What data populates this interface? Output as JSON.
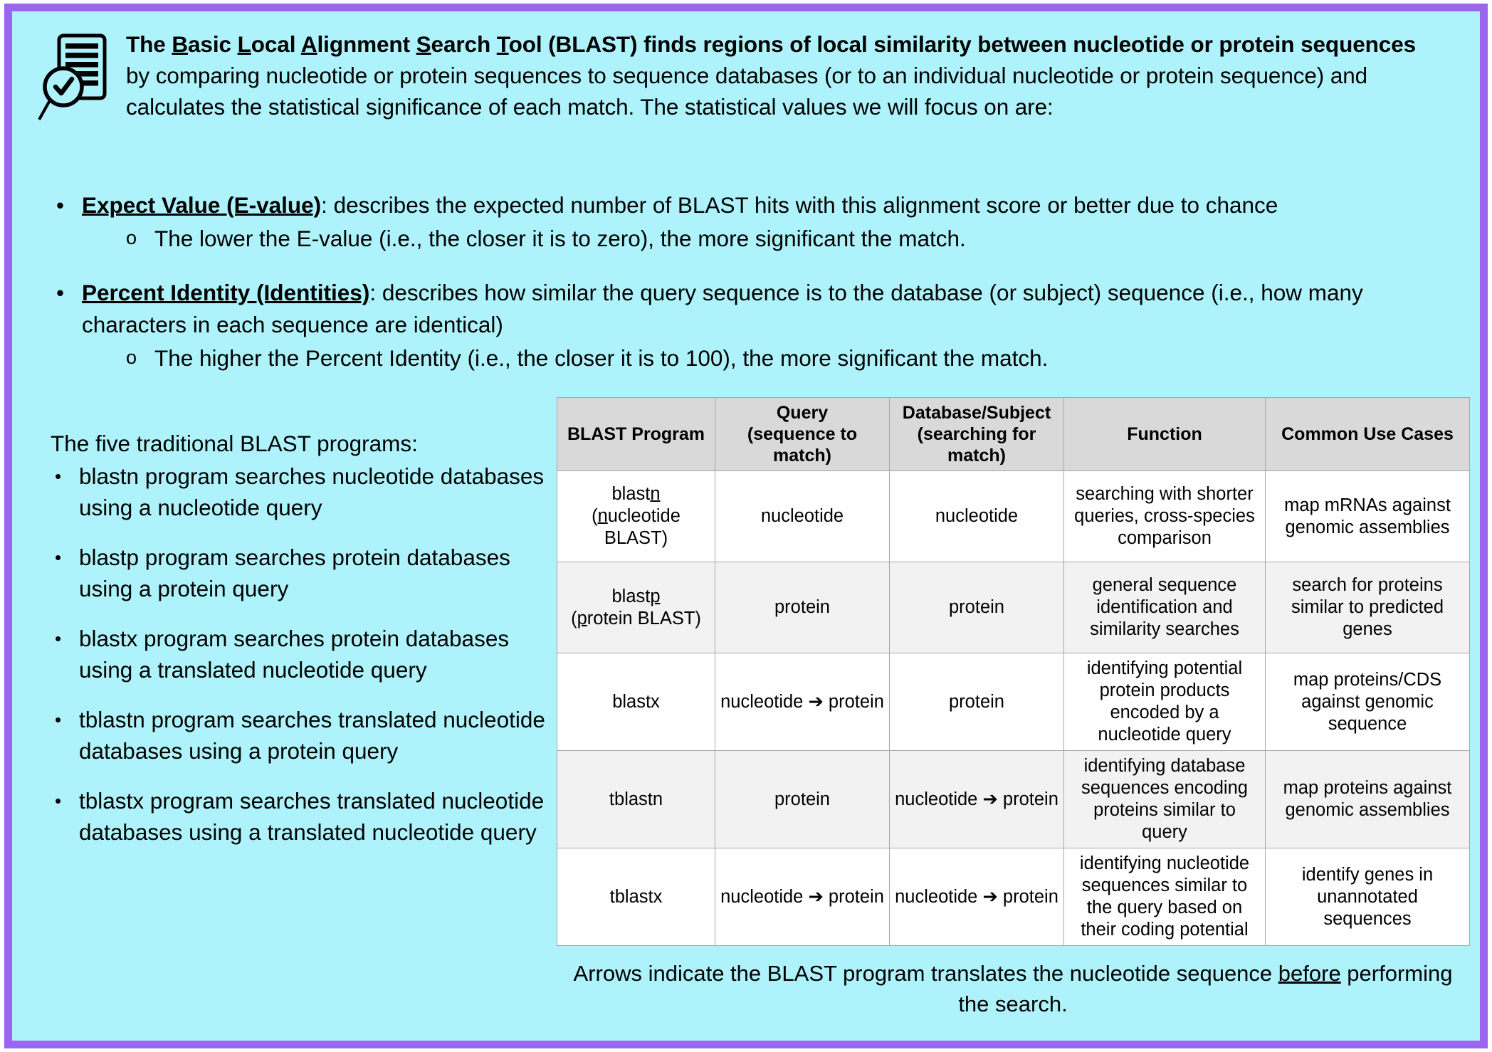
{
  "colors": {
    "frame_border": "#9a66f0",
    "background": "#aef3fb",
    "table_header_bg": "#d9d9d9",
    "table_row_shade": "#f2f2f2",
    "table_border": "#a6a6a6"
  },
  "header": {
    "icon": "document-magnifier-check-icon",
    "bold_lead": {
      "pre": "The ",
      "b1": "B",
      "w1": "asic ",
      "b2": "L",
      "w2": "ocal ",
      "b3": "A",
      "w3": "lignment ",
      "b4": "S",
      "w4": "earch ",
      "b5": "T",
      "w5": "ool (BLAST) finds regions of local similarity between nucleotide or protein sequences"
    },
    "rest": " by comparing nucleotide or protein sequences to sequence databases (or to an individual nucleotide or protein sequence) and calculates the statistical significance of each match. The statistical values we will focus on are:"
  },
  "stats": [
    {
      "bullet": "•",
      "term": "Expect Value (E-value)",
      "desc": ": describes the expected number of BLAST hits with this alignment score or better due to chance",
      "sub_marker": "o",
      "sub": "The lower the E-value (i.e., the closer it is to zero), the more significant the match."
    },
    {
      "bullet": "•",
      "term": "Percent Identity (Identities)",
      "desc": ": describes how similar the query sequence is to the database (or subject) sequence (i.e., how many characters in each sequence are identical)",
      "sub_marker": "o",
      "sub": "The higher the Percent Identity (i.e., the closer it is to 100), the more significant the match."
    }
  ],
  "programs": {
    "title": "The five traditional BLAST programs:",
    "bullet": "•",
    "items": [
      "blastn program searches nucleotide databases using a nucleotide query",
      "blastp program searches protein databases using a protein query",
      "blastx program searches protein databases using a translated nucleotide query",
      "tblastn program searches translated nucleotide databases using a protein query",
      "tblastx program searches translated nucleotide databases using a translated nucleotide query"
    ]
  },
  "table": {
    "headers": [
      {
        "line1": "BLAST Program",
        "line2": ""
      },
      {
        "line1": "Query",
        "line2": "(sequence to match)"
      },
      {
        "line1": "Database/Subject",
        "line2": "(searching for match)"
      },
      {
        "line1": "Function",
        "line2": ""
      },
      {
        "line1": "Common Use Cases",
        "line2": ""
      }
    ],
    "rows": [
      {
        "shaded": false,
        "program_line1_pre": "blast",
        "program_line1_u": "n",
        "program_line1_post": "",
        "program_line2_pre": "(",
        "program_line2_u": "n",
        "program_line2_post": "ucleotide BLAST)",
        "query": "nucleotide",
        "database": "nucleotide",
        "function": "searching with shorter queries, cross-species comparison",
        "use_cases": "map mRNAs against genomic assemblies"
      },
      {
        "shaded": true,
        "program_line1_pre": "blast",
        "program_line1_u": "p",
        "program_line1_post": "",
        "program_line2_pre": "(",
        "program_line2_u": "p",
        "program_line2_post": "rotein BLAST)",
        "query": "protein",
        "database": "protein",
        "function": "general sequence identification and similarity searches",
        "use_cases": "search for proteins similar to predicted genes"
      },
      {
        "shaded": false,
        "program_line1_pre": "blastx",
        "program_line1_u": "",
        "program_line1_post": "",
        "program_line2_pre": "",
        "program_line2_u": "",
        "program_line2_post": "",
        "query": "nucleotide ➔ protein",
        "database": "protein",
        "function": "identifying potential protein products encoded by a nucleotide query",
        "use_cases": "map proteins/CDS against genomic sequence"
      },
      {
        "shaded": true,
        "program_line1_pre": "tblastn",
        "program_line1_u": "",
        "program_line1_post": "",
        "program_line2_pre": "",
        "program_line2_u": "",
        "program_line2_post": "",
        "query": "protein",
        "database": "nucleotide ➔ protein",
        "function": "identifying database sequences encoding proteins similar to query",
        "use_cases": "map proteins against genomic assemblies"
      },
      {
        "shaded": false,
        "program_line1_pre": "tblastx",
        "program_line1_u": "",
        "program_line1_post": "",
        "program_line2_pre": "",
        "program_line2_u": "",
        "program_line2_post": "",
        "query": "nucleotide ➔ protein",
        "database": "nucleotide ➔ protein",
        "function": "identifying nucleotide sequences similar to the query based on their coding potential",
        "use_cases": "identify genes in unannotated sequences"
      }
    ]
  },
  "caption": {
    "pre": "Arrows indicate the BLAST program translates the nucleotide sequence ",
    "underlined": "before",
    "post": " performing the search."
  }
}
